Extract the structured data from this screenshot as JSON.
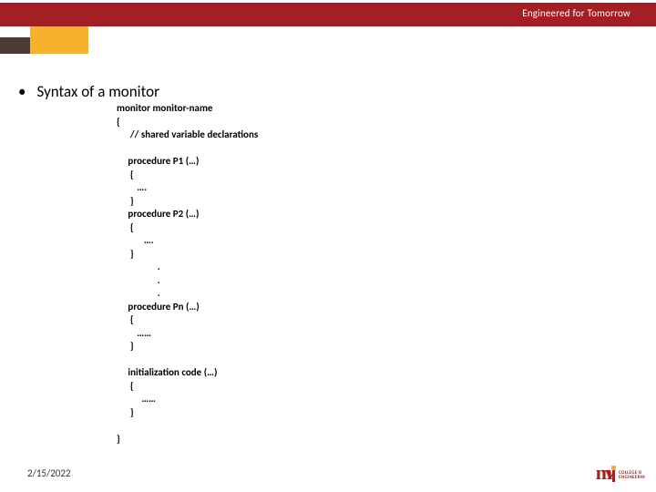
{
  "header": {
    "tagline": "Engineered for Tomorrow"
  },
  "slide": {
    "bullet_text": "Syntax of  a monitor",
    "code": "monitor monitor-name\n{\n      // shared variable declarations\n\n     procedure P1 (…)\n      {\n         ….\n      }\n     procedure P2 (…)\n      {\n            ….\n      }\n                  .\n                  .\n                  .\n     procedure Pn (…)\n      {\n         ……\n      }\n\n     initialization code (…)\n      {\n           ……\n      }\n\n}"
  },
  "footer": {
    "date": "2/15/2022",
    "logo_text": "m",
    "logo_tag_top": "COLLEGE O",
    "logo_tag_bottom": "ENGINEERIN"
  }
}
